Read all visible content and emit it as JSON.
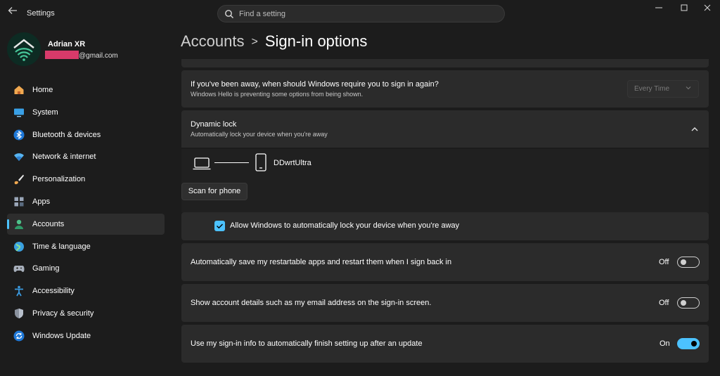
{
  "app": {
    "title": "Settings"
  },
  "search": {
    "placeholder": "Find a setting"
  },
  "window_controls": {
    "minimize": "—",
    "maximize": "☐",
    "close": "✕"
  },
  "user": {
    "name": "Adrian XR",
    "email_suffix": "@gmail.com"
  },
  "sidebar": {
    "items": [
      {
        "label": "Home",
        "icon": "home-icon"
      },
      {
        "label": "System",
        "icon": "system-icon"
      },
      {
        "label": "Bluetooth & devices",
        "icon": "bluetooth-icon"
      },
      {
        "label": "Network & internet",
        "icon": "network-icon"
      },
      {
        "label": "Personalization",
        "icon": "brush-icon"
      },
      {
        "label": "Apps",
        "icon": "apps-icon"
      },
      {
        "label": "Accounts",
        "icon": "accounts-icon",
        "active": true
      },
      {
        "label": "Time & language",
        "icon": "globe-icon"
      },
      {
        "label": "Gaming",
        "icon": "gamepad-icon"
      },
      {
        "label": "Accessibility",
        "icon": "accessibility-icon"
      },
      {
        "label": "Privacy & security",
        "icon": "shield-icon"
      },
      {
        "label": "Windows Update",
        "icon": "update-icon"
      }
    ]
  },
  "breadcrumb": {
    "parent": "Accounts",
    "separator": ">",
    "current": "Sign-in options"
  },
  "require_signin": {
    "title": "If you've been away, when should Windows require you to sign in again?",
    "subtitle": "Windows Hello is preventing some options from being shown.",
    "dropdown_value": "Every Time"
  },
  "dynamic_lock": {
    "title": "Dynamic lock",
    "subtitle": "Automatically lock your device when you're away",
    "device_name": "DDwrtUltra",
    "scan_button": "Scan for phone",
    "checkbox_label": "Allow Windows to automatically lock your device when you're away",
    "checkbox_checked": true
  },
  "settings": [
    {
      "label": "Automatically save my restartable apps and restart them when I sign back in",
      "state": "Off",
      "on": false
    },
    {
      "label": "Show account details such as my email address on the sign-in screen.",
      "state": "Off",
      "on": false
    },
    {
      "label": "Use my sign-in info to automatically finish setting up after an update",
      "state": "On",
      "on": true
    }
  ],
  "colors": {
    "accent": "#4cc2ff",
    "background": "#1c1c1c",
    "card": "#2b2b2b"
  }
}
